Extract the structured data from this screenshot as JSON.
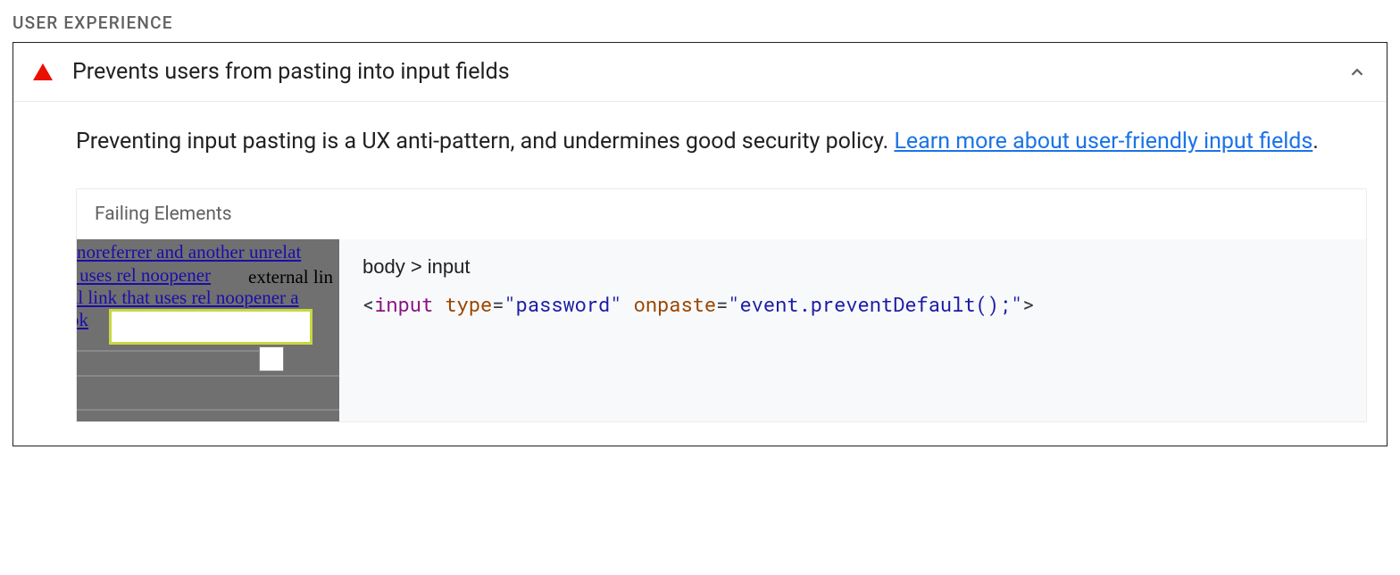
{
  "section": {
    "header": "USER EXPERIENCE"
  },
  "audit": {
    "title": "Prevents users from pasting into input fields",
    "description_prefix": "Preventing input pasting is a UX anti-pattern, and undermines good security policy. ",
    "learn_more_text": "Learn more about user-friendly input fields",
    "description_suffix": "."
  },
  "failing": {
    "header": "Failing Elements",
    "selector": "body > input",
    "code": {
      "open": "<",
      "tag": "input",
      "attr1_name": " type",
      "eq": "=",
      "attr1_val": "\"password\"",
      "attr2_name": " onpaste",
      "attr2_val": "\"event.preventDefault();\"",
      "close": ">"
    }
  },
  "thumbnail": {
    "line1": " noreferrer and another unrelat",
    "line2": "t uses rel noopener ",
    "line2b": "external lin",
    "line3": "al link that uses rel noopener a",
    "line4": " ok"
  }
}
